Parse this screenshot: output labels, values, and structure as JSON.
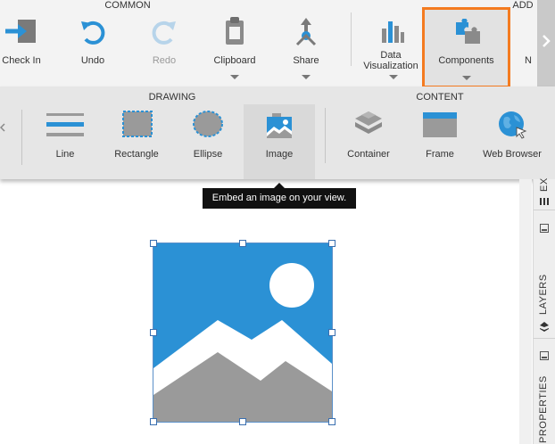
{
  "ribbon": {
    "groups": {
      "common": "COMMON",
      "add": "ADD",
      "drawing": "DRAWING",
      "content": "CONTENT"
    },
    "common": {
      "check_in": "Check In",
      "undo": "Undo",
      "redo": "Redo",
      "clipboard": "Clipboard",
      "share": "Share"
    },
    "add": {
      "data_viz_line1": "Data",
      "data_viz_line2": "Visualization",
      "components": "Components",
      "next_partial": "N"
    },
    "drawing": {
      "line": "Line",
      "rectangle": "Rectangle",
      "ellipse": "Ellipse",
      "image": "Image"
    },
    "content": {
      "container": "Container",
      "frame": "Frame",
      "web_browser": "Web Browser"
    }
  },
  "tooltip": {
    "text": "Embed an image on your view."
  },
  "sidebar": {
    "layers": "LAYERS",
    "properties": "PROPERTIES",
    "top_partial": "EX"
  },
  "colors": {
    "accent": "#2b91d5",
    "highlight": "#f47b20",
    "selected": "#d9d9d9"
  }
}
